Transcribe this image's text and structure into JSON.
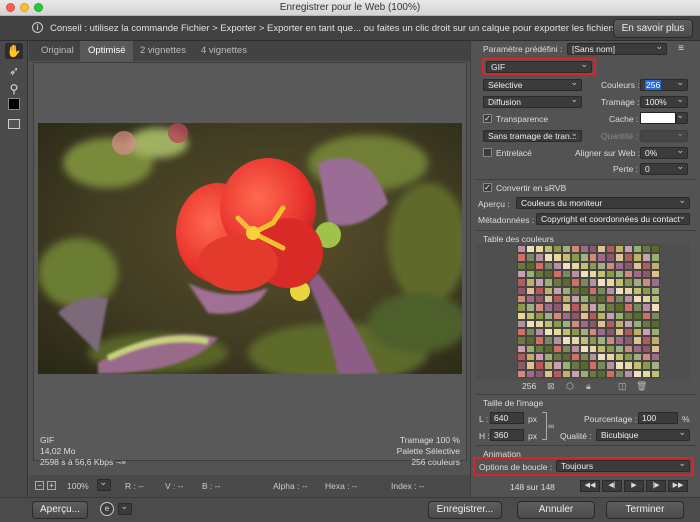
{
  "window": {
    "title": "Enregistrer pour le Web (100%)"
  },
  "tip": {
    "text": "Conseil : utilisez la commande Fichier > Exporter > Exporter en tant que... ou faites un clic droit sur un calque pour exporter les fichiers plus rapidement.",
    "learn_more": "En savoir plus"
  },
  "tabs": [
    "Original",
    "Optimisé",
    "2 vignettes",
    "4 vignettes"
  ],
  "preview_info": {
    "format": "GIF",
    "size": "14,02 Mo",
    "timing": "2598 s à 56,6 Kbps",
    "timing_menu": "⇁≡",
    "dither": "Tramage 100 %",
    "palette": "Palette Sélective",
    "colors": "256 couleurs"
  },
  "statusbar": {
    "zoom": "100%",
    "r": "R : --",
    "v": "V : --",
    "b": "B : --",
    "alpha": "Alpha : --",
    "hexa": "Hexa : --",
    "index": "Index : --"
  },
  "settings": {
    "preset_label": "Paramètre prédéfini :",
    "preset_value": "[Sans nom]",
    "format": "GIF",
    "reduction": "Sélective",
    "colors_label": "Couleurs :",
    "colors_value": "256",
    "dither_algo": "Diffusion",
    "dither_label": "Tramage :",
    "dither_value": "100%",
    "transparency_label": "Transparence",
    "matte_label": "Cache :",
    "transparency_dither": "Sans tramage de tran...",
    "amount_label": "Quantité :",
    "interlaced_label": "Entrelacé",
    "websnap_label": "Aligner sur Web :",
    "websnap_value": "0%",
    "lossy_label": "Perte :",
    "lossy_value": "0",
    "srgb_label": "Convertir en sRVB",
    "preview_label": "Aperçu :",
    "preview_value": "Couleurs du moniteur",
    "metadata_label": "Métadonnées :",
    "metadata_value": "Copyright et coordonnées du contact"
  },
  "color_table": {
    "title": "Table des couleurs",
    "count": "256"
  },
  "image_size": {
    "title": "Taille de l'image",
    "w_label": "L :",
    "w_value": "640",
    "h_label": "H :",
    "h_value": "360",
    "unit": "px",
    "percent_label": "Pourcentage :",
    "percent_value": "100",
    "percent_unit": "%",
    "quality_label": "Qualité :",
    "quality_value": "Bicubique"
  },
  "animation": {
    "title": "Animation",
    "loop_label": "Options de boucle :",
    "loop_value": "Toujours",
    "frame": "148 sur 148"
  },
  "buttons": {
    "preview": "Aperçu...",
    "save": "Enregistrer...",
    "cancel": "Annuler",
    "done": "Terminer"
  },
  "colors": {
    "accent_red": "#d8252b",
    "bg": "#535353",
    "selected_field": "#2a6ad8"
  }
}
